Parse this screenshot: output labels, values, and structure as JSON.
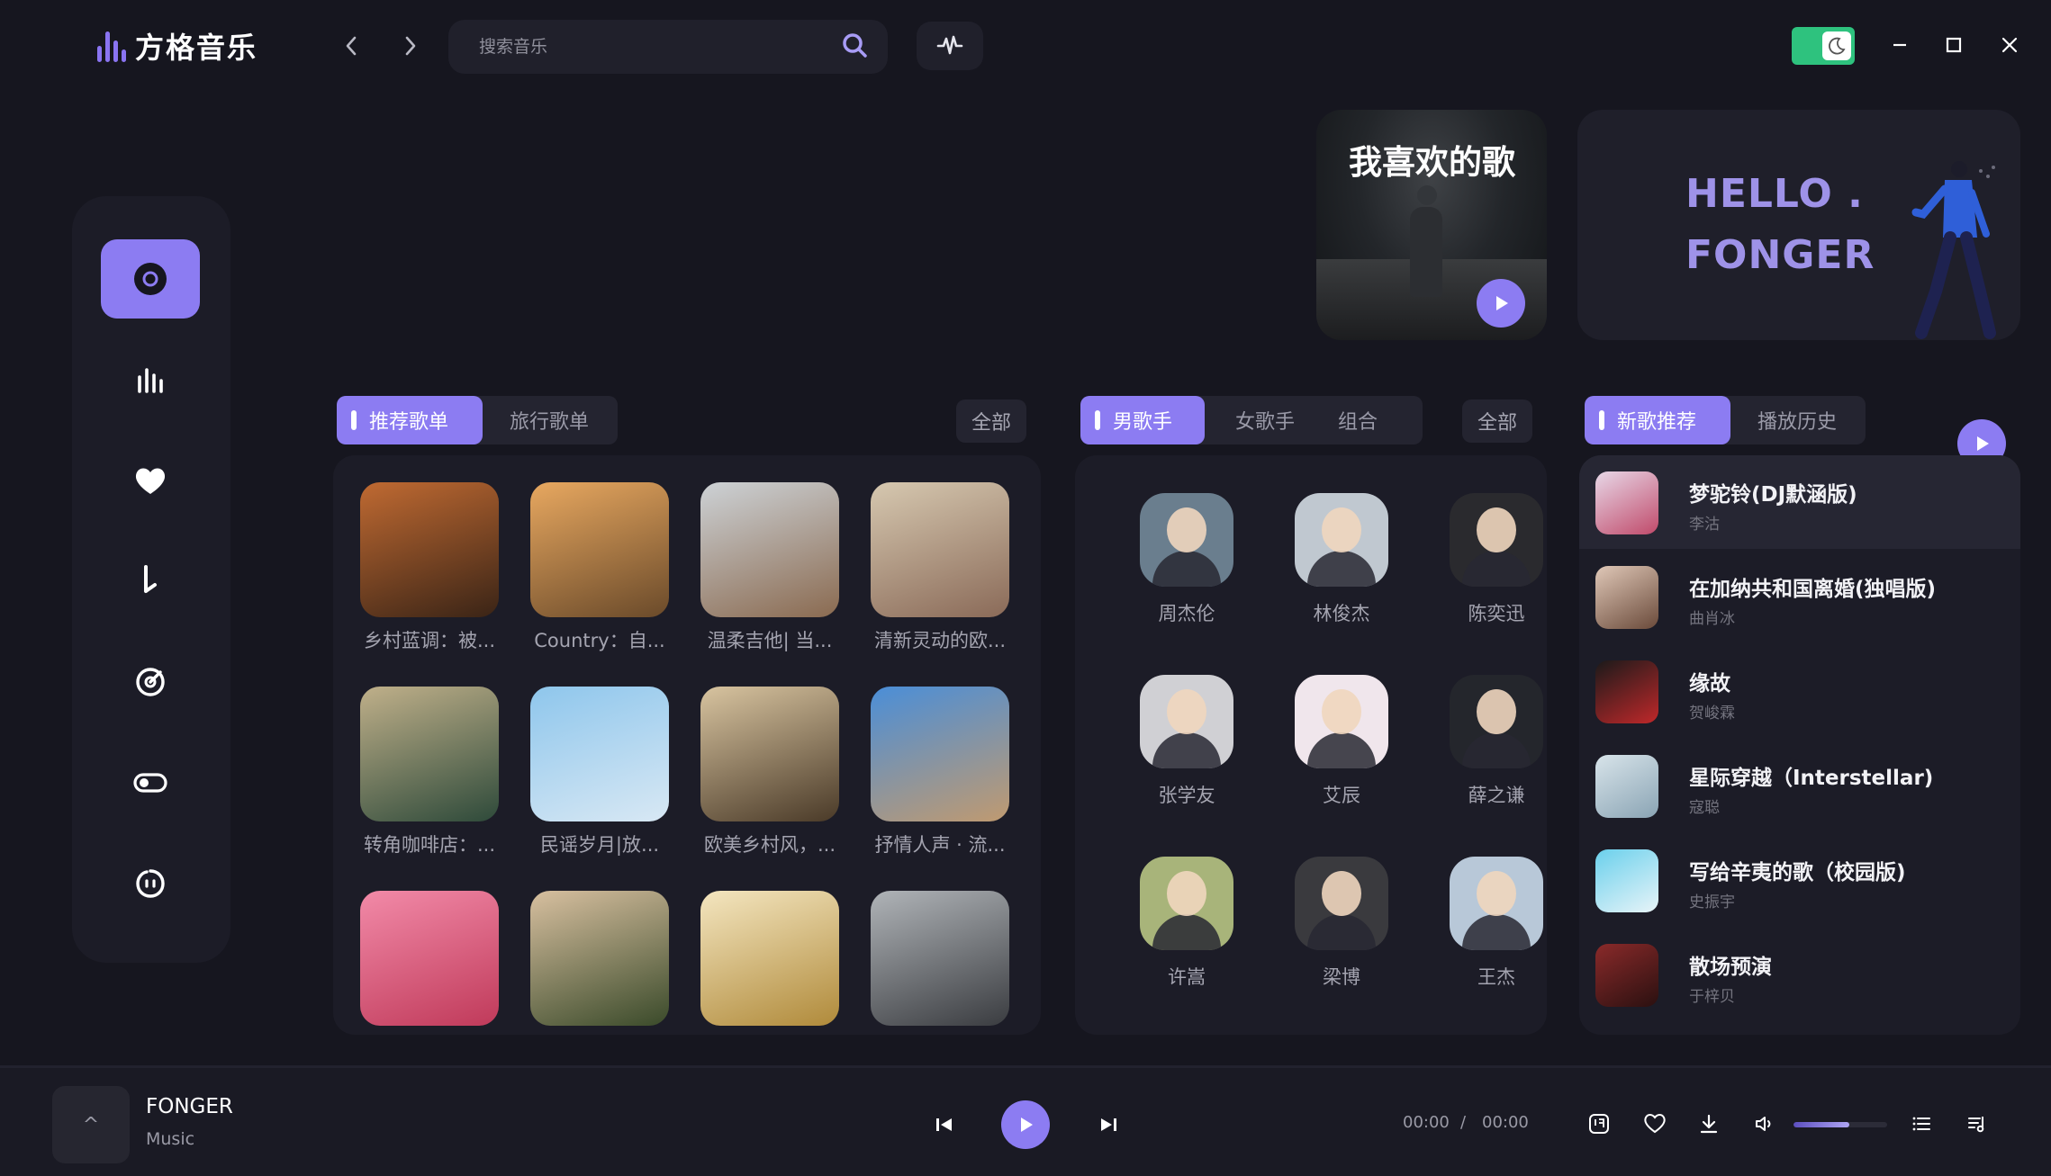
{
  "app": {
    "title": "方格音乐"
  },
  "search": {
    "placeholder": "搜索音乐"
  },
  "hero": {
    "favorite_title": "我喜欢的歌",
    "hello_line1": "HELLO .",
    "hello_line2": "FONGER"
  },
  "sidebar": {
    "items": [
      {
        "icon": "disc-icon",
        "active": true
      },
      {
        "icon": "chart-bars-icon",
        "active": false
      },
      {
        "icon": "heart-icon",
        "active": false
      },
      {
        "icon": "music-note-icon",
        "active": false
      },
      {
        "icon": "radar-icon",
        "active": false
      },
      {
        "icon": "toggle-icon",
        "active": false
      },
      {
        "icon": "face-icon",
        "active": false
      }
    ]
  },
  "playlists": {
    "tabs": [
      {
        "label": "推荐歌单",
        "active": true
      },
      {
        "label": "旅行歌单",
        "active": false
      }
    ],
    "all_label": "全部",
    "items": [
      {
        "label": "乡村蓝调：被...",
        "colors": [
          "#c06a32",
          "#3a2416"
        ]
      },
      {
        "label": "Country：自...",
        "colors": [
          "#e8a860",
          "#6a4a2a"
        ]
      },
      {
        "label": "温柔吉他| 当...",
        "colors": [
          "#cdd2d6",
          "#8a6a50"
        ]
      },
      {
        "label": "清新灵动的欧...",
        "colors": [
          "#d6c8b0",
          "#8a6a58"
        ]
      },
      {
        "label": "转角咖啡店：...",
        "colors": [
          "#c0b08a",
          "#2e4a3a"
        ]
      },
      {
        "label": "民谣岁月|放...",
        "colors": [
          "#8ec6ec",
          "#d8e8f4"
        ]
      },
      {
        "label": "欧美乡村风，...",
        "colors": [
          "#d8c4a0",
          "#4a3a28"
        ]
      },
      {
        "label": "抒情人声 · 流...",
        "colors": [
          "#4a8ed8",
          "#c09a70"
        ]
      },
      {
        "label": "",
        "colors": [
          "#f28aa8",
          "#c03a5a"
        ]
      },
      {
        "label": "",
        "colors": [
          "#d8c0a0",
          "#3a4a2a"
        ]
      },
      {
        "label": "",
        "colors": [
          "#f4e6c0",
          "#b08a3a"
        ]
      },
      {
        "label": "",
        "colors": [
          "#b0b4b8",
          "#3a3c40"
        ]
      }
    ]
  },
  "singers": {
    "tabs": [
      {
        "label": "男歌手",
        "active": true
      },
      {
        "label": "女歌手",
        "active": false
      },
      {
        "label": "组合",
        "active": false
      }
    ],
    "all_label": "全部",
    "items": [
      {
        "name": "周杰伦",
        "bg": "#6a7e8e"
      },
      {
        "name": "林俊杰",
        "bg": "#c0c8d0"
      },
      {
        "name": "陈奕迅",
        "bg": "#2a2a2e"
      },
      {
        "name": "张学友",
        "bg": "#d0d0d4"
      },
      {
        "name": "艾辰",
        "bg": "#f0e6ec"
      },
      {
        "name": "薛之谦",
        "bg": "#24262c"
      },
      {
        "name": "许嵩",
        "bg": "#a8b47a"
      },
      {
        "name": "梁博",
        "bg": "#3a3a3e"
      },
      {
        "name": "王杰",
        "bg": "#b8c8d8"
      }
    ]
  },
  "songs": {
    "tabs": [
      {
        "label": "新歌推荐",
        "active": true
      },
      {
        "label": "播放历史",
        "active": false
      }
    ],
    "items": [
      {
        "title": "梦驼铃(DJ默涵版)",
        "artist": "李沽",
        "colors": [
          "#e8d8e8",
          "#c04a6a"
        ]
      },
      {
        "title": "在加纳共和国离婚(独唱版)",
        "artist": "曲肖冰",
        "colors": [
          "#e0c8b8",
          "#6a4a3a"
        ]
      },
      {
        "title": "缘故",
        "artist": "贺峻霖",
        "colors": [
          "#1a1a1a",
          "#c0282a"
        ]
      },
      {
        "title": "星际穿越（Interstellar)",
        "artist": "寇聪",
        "colors": [
          "#d8e4ea",
          "#8aa4b4"
        ]
      },
      {
        "title": "写给辛夷的歌（校园版)",
        "artist": "史振宇",
        "colors": [
          "#6ad0ec",
          "#e8f4f8"
        ]
      },
      {
        "title": "散场预演",
        "artist": "于梓贝",
        "colors": [
          "#8a2a2a",
          "#2a1010"
        ]
      }
    ]
  },
  "player": {
    "title": "FONGER",
    "subtitle": "Music",
    "cover_symbol": "^",
    "current_time": "00:00",
    "separator": "/",
    "total_time": "00:00",
    "volume": 0.6
  },
  "colors": {
    "accent": "#8c7cf2",
    "background": "#16161f",
    "panel": "#1c1c27",
    "toggle": "#2ec27e"
  }
}
